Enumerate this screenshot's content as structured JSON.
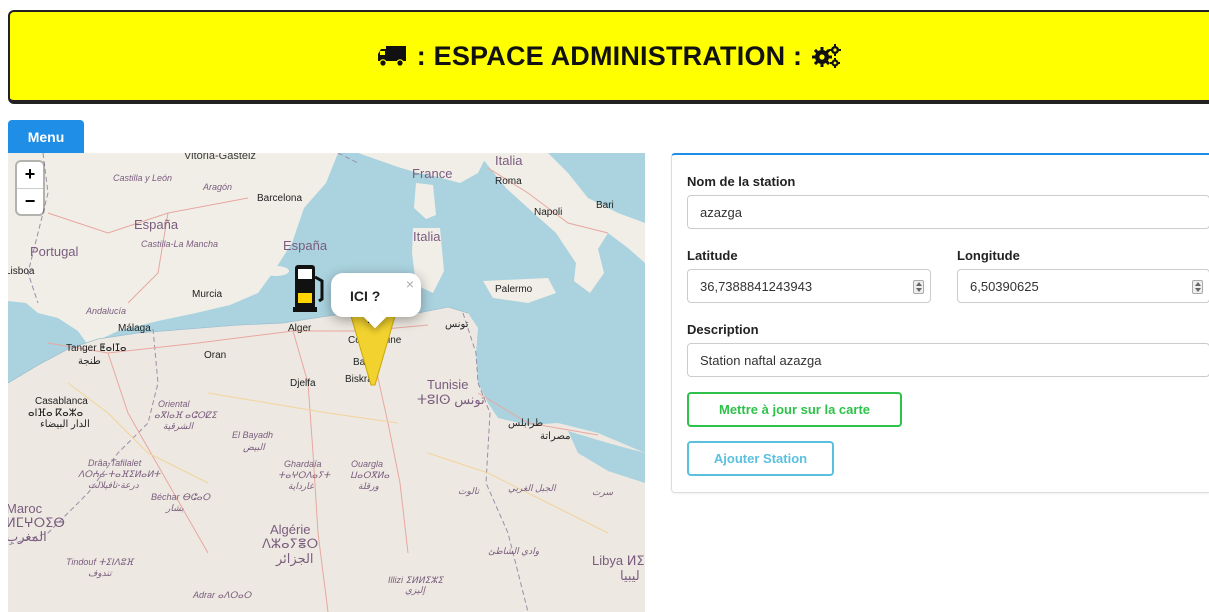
{
  "header": {
    "title": ": ESPACE ADMINISTRATION :",
    "left_icon": "truck-icon",
    "right_icon": "gears-icon",
    "bg_color": "#ffff00"
  },
  "menu": {
    "label": "Menu",
    "color": "#1f8ee6"
  },
  "map": {
    "zoom_in": "+",
    "zoom_out": "−",
    "popup": {
      "text": "ICI ?",
      "close": "×"
    },
    "marker_icon": "fuel-pump-icon",
    "pin_icon": "map-pin-icon",
    "labels": {
      "vitoria": "Vitoria-Gasteiz",
      "castilla": "Castilla y León",
      "aragon": "Aragón",
      "barcelona": "Barcelona",
      "espana1": "España",
      "castilla_mancha": "Castilla-La Mancha",
      "espana2": "España",
      "portugal": "Portugal",
      "lisboa": "Lisboa",
      "murcia": "Murcia",
      "andalucia": "Andalucía",
      "malaga": "Málaga",
      "tanger": "Tanger ⵟⴰⵏⵊⴰ",
      "tanja": "طنجة",
      "oran": "Oran",
      "alger": "Alger",
      "france": "France",
      "italia1": "Italia",
      "roma": "Roma",
      "napoli": "Napoli",
      "bari": "Bari",
      "italia2": "Italia",
      "palermo": "Palermo",
      "tunis": "تونس",
      "constantine": "Constantine",
      "batna": "Batna",
      "biskra": "Biskra",
      "djelfa": "Djelfa",
      "tunisie": "Tunisie",
      "tunisie_ar": "ⵜⵓⵏⵙ تونس",
      "casablanca": "Casablanca",
      "casa_tif": "ⴰⵏⴼⴰ ⴽⴰⵣⴰ",
      "casa_ar": "الدار البيضاء",
      "oriental": "Oriental",
      "oriental_tif": "ⴰⴳⵏⴰⴼ ⴰⵛⵔⵇⵉ",
      "oriental_ar": "الشرقية",
      "el_bayadh": "El Bayadh",
      "el_bayadh_ar": "البيض",
      "draa": "Drâa-Tafilalet",
      "draa_tif": "ⴷⵔⵄⴰ-ⵜⴰⴼⵉⵍⴰⵍⵜ",
      "draa_ar": "درعة-تافيلالت",
      "ghardaia": "Ghardaïa",
      "ghardaia_tif": "ⵜⴰⵖⵔⴷⴰⵢⵜ",
      "ghardaia_ar": "غارداية",
      "ouargla": "Ouargla",
      "ouargla_tif": "ⵡⴰⵔⴳⵍⴰ",
      "ouargla_ar": "ورقلة",
      "tarabulus": "طرابلس",
      "misrata": "مصراتة",
      "talut": "تالوت",
      "jabal": "الجبل الغربي",
      "sirte": "سرت",
      "bechar": "Béchar ⴱⵛⴰⵔ",
      "bechar_ar": "بشار",
      "maroc": "Maroc",
      "maroc_tif": "ⵍⵎⵖⵔⵉⴱ",
      "maroc_ar": "المغرب",
      "algerie": "Algérie",
      "algerie_tif": "ⴷⵣⴰⵢⴻⵔ",
      "algerie_ar": "الجزائر",
      "tindouf": "Tindouf ⵜⵉⵏⴷⵓⴼ",
      "tindouf_ar": "تندوف",
      "wadi": "وادي الشاطئ",
      "libya": "Libya ⵍⵉⴱⵢⴰ",
      "libya_ar": "ليبيا",
      "illizi": "Illizi ⵉⵍⵍⵉⵣⵉ",
      "illizi_ar": "إليزي",
      "adrar": "Adrar ⴰⴷⵔⴰⵔ"
    }
  },
  "form": {
    "name_label": "Nom de la station",
    "name_value": "azazga",
    "lat_label": "Latitude",
    "lat_value": "36,7388841243943",
    "lon_label": "Longitude",
    "lon_value": "6,50390625",
    "desc_label": "Description",
    "desc_value": "Station naftal azazga",
    "update_button": "Mettre à jour sur la carte",
    "add_button": "Ajouter Station",
    "green": "#2ec24a",
    "blue": "#5bc0de"
  }
}
